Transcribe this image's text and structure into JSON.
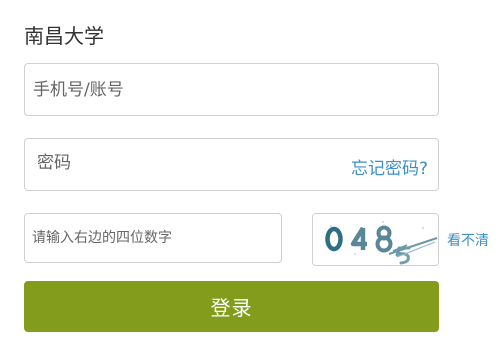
{
  "header": {
    "school_name": "南昌大学"
  },
  "form": {
    "account_placeholder": "手机号/账号",
    "password_placeholder": "密码",
    "forgot_password": "忘记密码?",
    "captcha_placeholder": "请输入右边的四位数字",
    "captcha_image_text": "0485",
    "refresh_captcha": "看不清",
    "login_button": "登录"
  },
  "colors": {
    "login_button": "#849c1b",
    "link": "#3d8fc6",
    "border": "#d0d0d0"
  }
}
